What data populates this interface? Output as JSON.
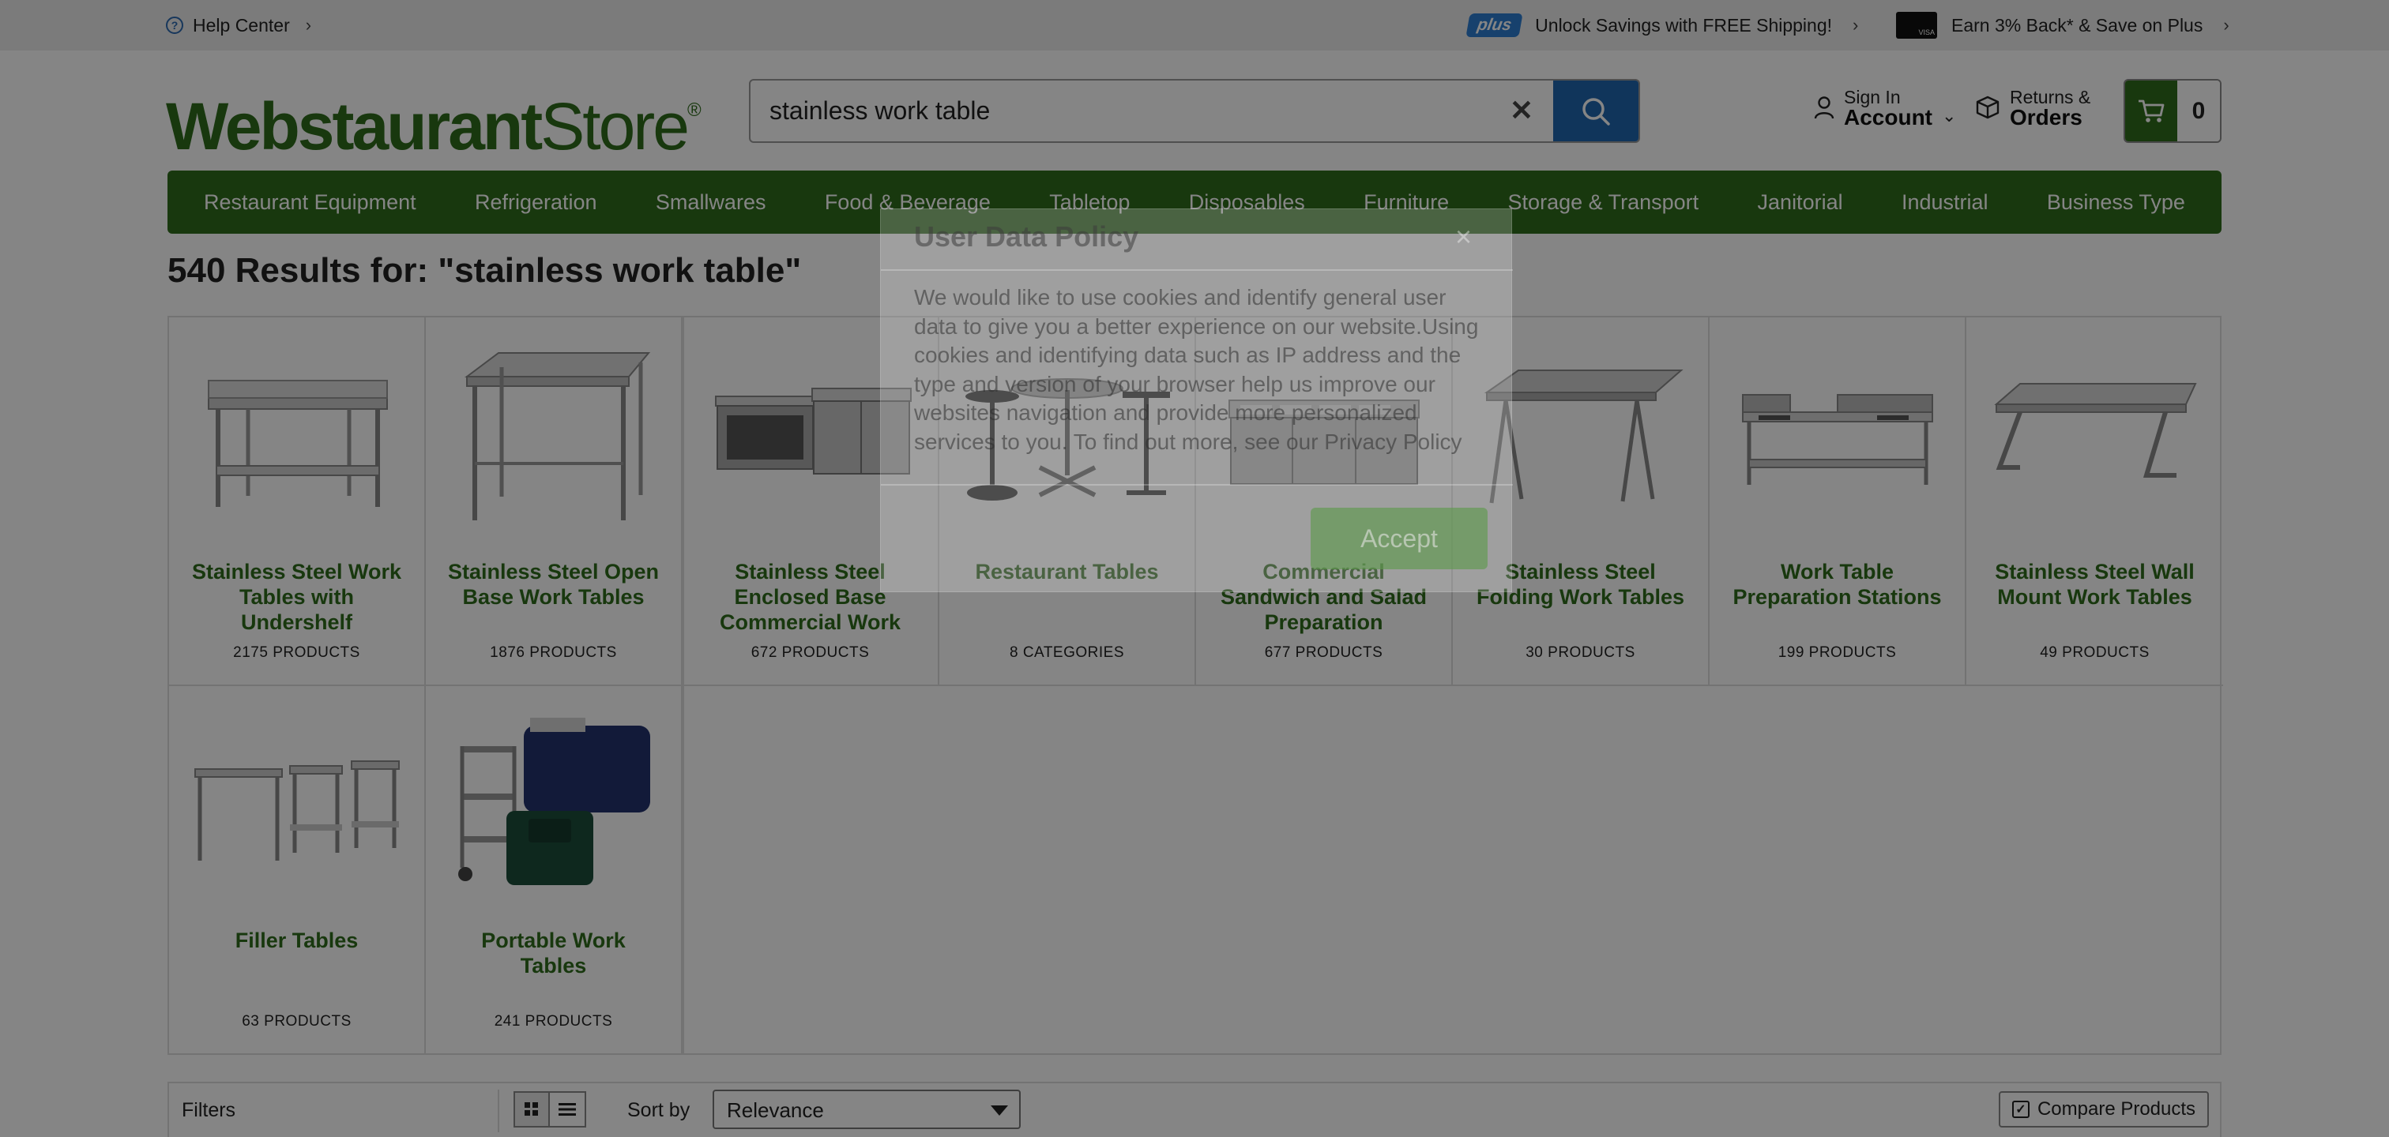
{
  "topbar": {
    "help_center": "Help Center",
    "plus_badge": "plus",
    "shipping_promo": "Unlock Savings with FREE Shipping!",
    "card_promo": "Earn 3% Back* & Save on Plus"
  },
  "header": {
    "logo_bold": "Webstaurant",
    "logo_light": "Store",
    "logo_mark": "®",
    "search": {
      "value": "stainless work table",
      "placeholder": ""
    },
    "account": {
      "small": "Sign In",
      "big": "Account"
    },
    "orders": {
      "small": "Returns &",
      "big": "Orders"
    },
    "cart_count": "0"
  },
  "nav": {
    "items": [
      "Restaurant Equipment",
      "Refrigeration",
      "Smallwares",
      "Food & Beverage",
      "Tabletop",
      "Disposables",
      "Furniture",
      "Storage & Transport",
      "Janitorial",
      "Industrial",
      "Business Type"
    ]
  },
  "results": {
    "count": "540 Results for:",
    "term": "\"stainless work table\""
  },
  "tiles": [
    {
      "name": "Stainless Steel Work Tables with Undershelf",
      "count": "2175 PRODUCTS",
      "icon": "work-table-undershelf"
    },
    {
      "name": "Stainless Steel Open Base Work Tables",
      "count": "1876 PRODUCTS",
      "icon": "open-base-table"
    },
    {
      "name": "Stainless Steel Enclosed Base Commercial Work",
      "count": "672 PRODUCTS",
      "icon": "enclosed-base-table"
    },
    {
      "name": "Restaurant Tables",
      "count": "8 CATEGORIES",
      "icon": "restaurant-tables"
    },
    {
      "name": "Commercial Sandwich and Salad Preparation",
      "count": "677 PRODUCTS",
      "icon": "sandwich-prep"
    },
    {
      "name": "Stainless Steel Folding Work Tables",
      "count": "30 PRODUCTS",
      "icon": "folding-table"
    },
    {
      "name": "Work Table Preparation Stations",
      "count": "199 PRODUCTS",
      "icon": "prep-station"
    },
    {
      "name": "Stainless Steel Wall Mount Work Tables",
      "count": "49 PRODUCTS",
      "icon": "wall-mount-table"
    },
    {
      "name": "Filler Tables",
      "count": "63 PRODUCTS",
      "icon": "filler-tables"
    },
    {
      "name": "Portable Work Tables",
      "count": "241 PRODUCTS",
      "icon": "portable-cart"
    }
  ],
  "toolbar": {
    "filters": "Filters",
    "sort_label": "Sort by",
    "sort_value": "Relevance",
    "compare": "Compare Products"
  },
  "modal": {
    "title": "User Data Policy",
    "close": "×",
    "body": "We would like to use cookies and identify general user data to give you a better experience on our website.Using cookies and identifying data such as IP address and the type and version of your browser help us improve our websites navigation and provide more personalized services to you. To find out more, see our Privacy Policy",
    "accept": "Accept"
  },
  "colors": {
    "brand_green": "#2f6b1c",
    "search_blue": "#1f66ae",
    "topbar_gray": "#ebebeb"
  }
}
